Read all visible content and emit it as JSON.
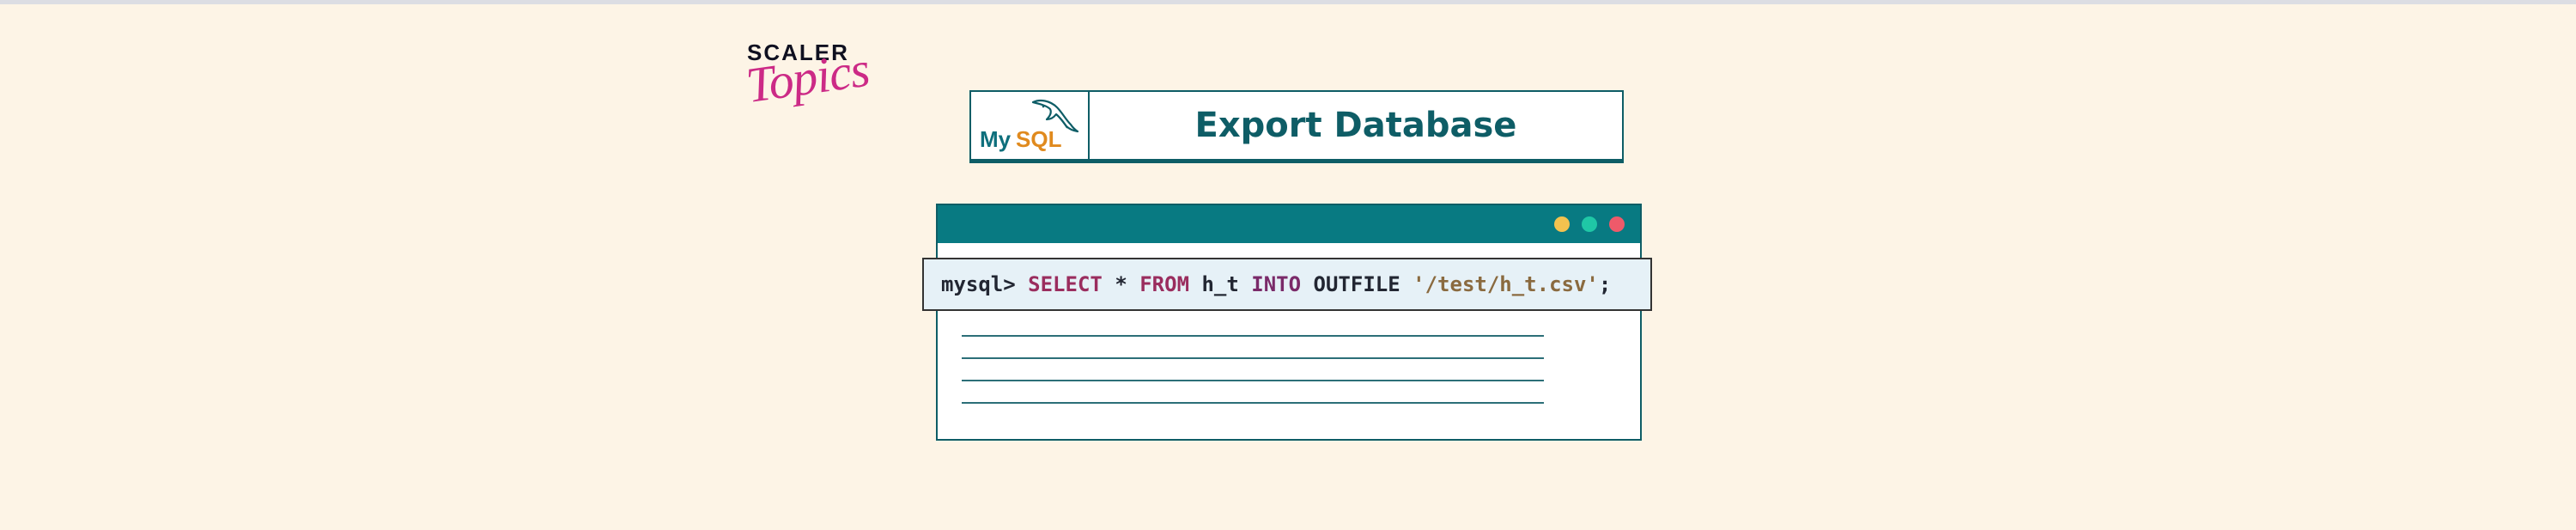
{
  "brand": {
    "line1": "SCALER",
    "line2": "Topics",
    "accent_color": "#cc2a86"
  },
  "title_card": {
    "logo": {
      "icon": "mysql-dolphin-icon",
      "text_my": "My",
      "text_sql": "SQL"
    },
    "title": "Export Database"
  },
  "terminal": {
    "titlebar_color": "#087a82",
    "window_controls": [
      {
        "name": "minimize",
        "color": "#f3c24f"
      },
      {
        "name": "maximize",
        "color": "#1fc7a6"
      },
      {
        "name": "close",
        "color": "#ee5a6a"
      }
    ],
    "command": {
      "prompt": "mysql>",
      "kw_select": "SELECT",
      "star": "*",
      "kw_from": "FROM",
      "table": "h_t",
      "kw_into": "INTO",
      "kw_outfile": "OUTFILE",
      "path": "'/test/h_t.csv'",
      "terminator": ";"
    },
    "output_line_count": 4
  },
  "colors": {
    "background": "#fdf4e6",
    "teal": "#0e5d66"
  }
}
